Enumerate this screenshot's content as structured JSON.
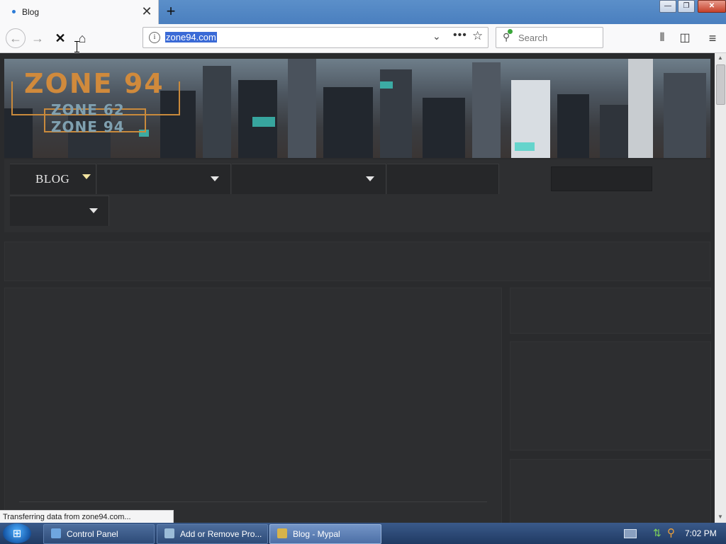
{
  "browser": {
    "tab": {
      "title": "Blog",
      "close": "✕"
    },
    "new_tab": "+",
    "window_buttons": {
      "minimize": "—",
      "maximize": "❐",
      "close": "✕"
    },
    "url": "zone94.com",
    "url_info_icon": "i",
    "url_dropdown": "⌄",
    "page_actions": "•••",
    "bookmark_star": "☆",
    "search_placeholder": "Search",
    "nav_icons": {
      "back": "←",
      "forward": "→",
      "stop": "✕",
      "home": "⌂",
      "library": "⫴",
      "sidebar": "◫",
      "menu": "≡",
      "search": "⚲"
    },
    "status": "Transferring data from zone94.com..."
  },
  "page": {
    "logo": {
      "main": "ZONE 94",
      "sub1": "ZONE 62",
      "sub2": "ZONE 94"
    },
    "menu": {
      "blog_label": "BLOG"
    }
  },
  "taskbar": {
    "start_glyph": "⊞",
    "items": [
      {
        "label": "Control Panel"
      },
      {
        "label": "Add or Remove Pro..."
      },
      {
        "label": "Blog - Mypal"
      }
    ],
    "tray": {
      "network": "⇅",
      "search": "⚲"
    },
    "clock": "7:02 PM"
  },
  "colors": {
    "accent_logo": "#d08a3c",
    "selection": "#3a6ad6",
    "page_bg": "#2a2b2d"
  }
}
